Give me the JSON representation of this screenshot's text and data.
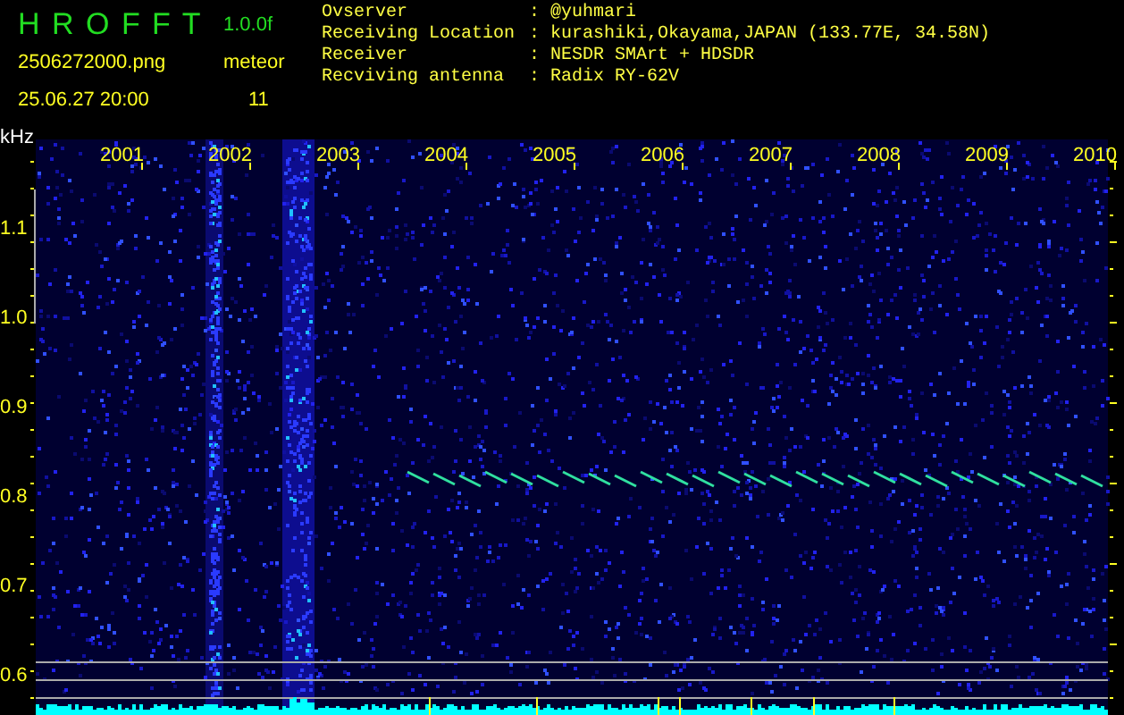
{
  "header": {
    "title": "H R O F F T",
    "version": "1.0.0f",
    "filename": "2506272000.png",
    "datetime": "25.06.27 20:00",
    "count_label": "meteor",
    "count": "11"
  },
  "info": [
    {
      "label": "Ovserver",
      "value": ": @yuhmari"
    },
    {
      "label": "Receiving Location",
      "value": ": kurashiki,Okayama,JAPAN (133.77E, 34.58N)"
    },
    {
      "label": "Receiver",
      "value": ": NESDR SMArt + HDSDR"
    },
    {
      "label": "Recviving antenna",
      "value": ": Radix RY-62V"
    }
  ],
  "plot": {
    "unit": "kHz",
    "time_labels": [
      "2001",
      "2002",
      "2003",
      "2004",
      "2005",
      "2006",
      "2007",
      "2008",
      "2009",
      "2010"
    ],
    "freq_labels": [
      "1.1",
      "1.0",
      "0.9",
      "0.8",
      "0.7",
      "0.6"
    ]
  }
}
